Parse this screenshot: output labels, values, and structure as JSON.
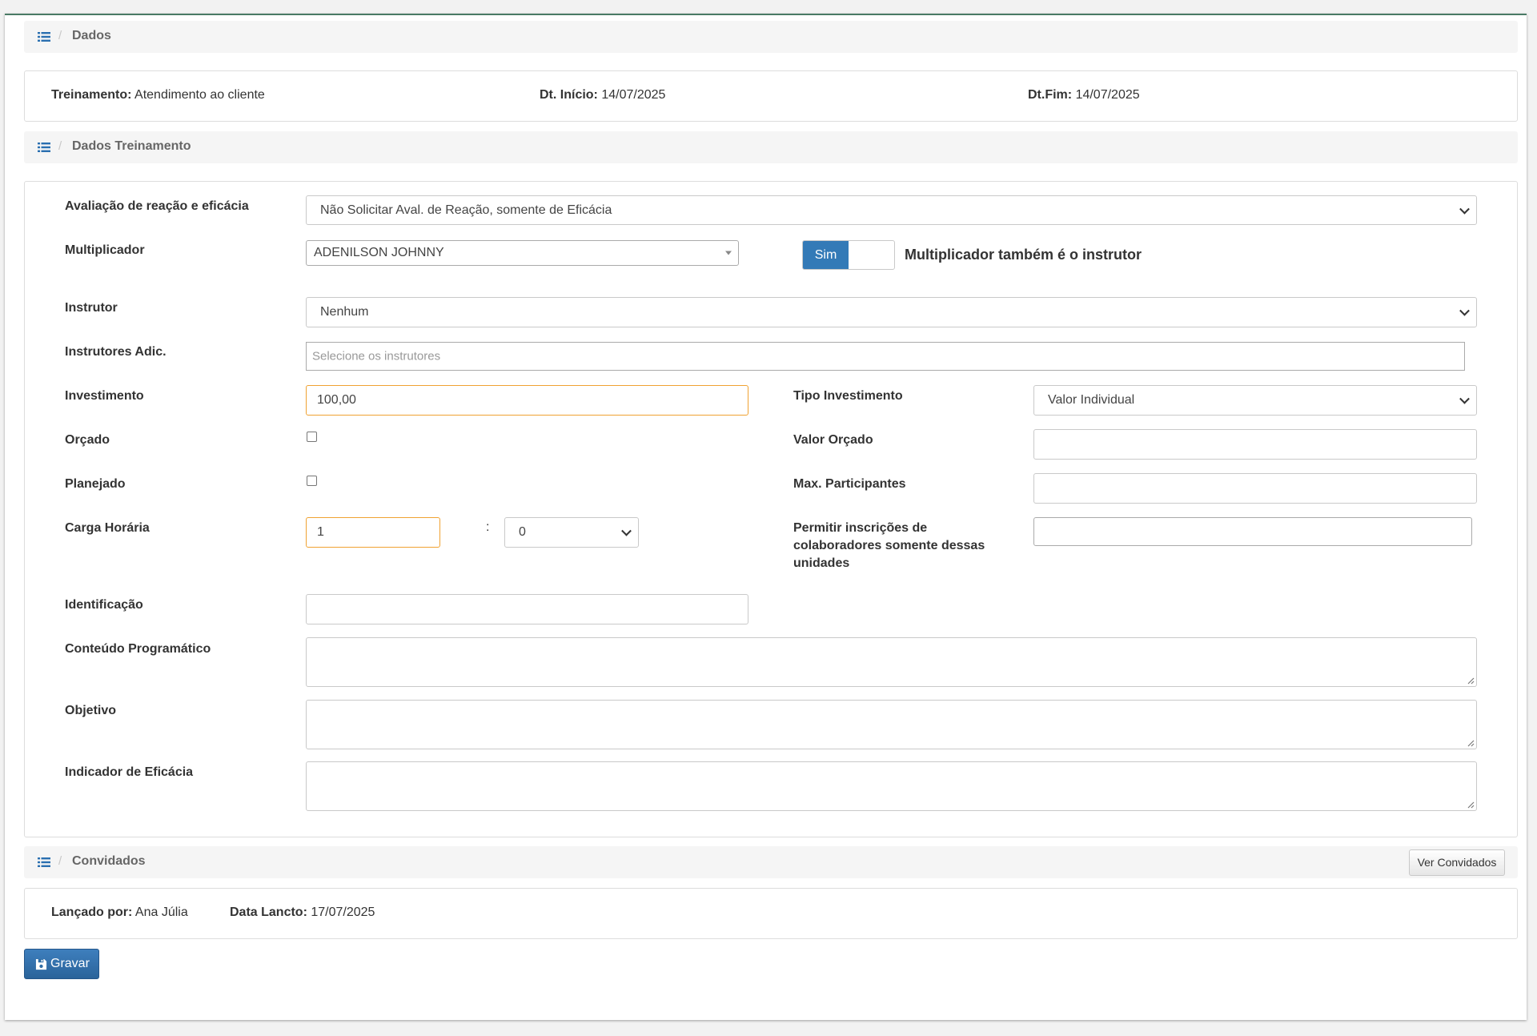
{
  "sections": {
    "dados": "Dados",
    "dados_treinamento": "Dados Treinamento",
    "convidados": "Convidados"
  },
  "summary": {
    "treinamento_label": "Treinamento:",
    "treinamento_value": "Atendimento ao cliente",
    "dt_inicio_label": "Dt. Início:",
    "dt_inicio_value": "14/07/2025",
    "dt_fim_label": "Dt.Fim:",
    "dt_fim_value": "14/07/2025"
  },
  "form": {
    "avaliacao_label": "Avaliação de reação e eficácia",
    "avaliacao_value": "Não Solicitar Aval. de Reação, somente de Eficácia",
    "multiplicador_label": "Multiplicador",
    "multiplicador_value": "ADENILSON JOHNNY",
    "toggle_on_label": "Sim",
    "toggle_caption": "Multiplicador também é o instrutor",
    "instrutor_label": "Instrutor",
    "instrutor_value": "Nenhum",
    "instrutores_adic_label": "Instrutores Adic.",
    "instrutores_adic_placeholder": "Selecione os instrutores",
    "investimento_label": "Investimento",
    "investimento_value": "100,00",
    "tipo_investimento_label": "Tipo Investimento",
    "tipo_investimento_value": "Valor Individual",
    "orcado_label": "Orçado",
    "valor_orcado_label": "Valor Orçado",
    "planejado_label": "Planejado",
    "max_participantes_label": "Max. Participantes",
    "carga_horaria_label": "Carga Horária",
    "carga_horas_value": "1",
    "carga_separator": ":",
    "carga_minutos_value": "0",
    "permitir_label_line1": "Permitir inscrições de",
    "permitir_label_line2": "colaboradores somente dessas",
    "permitir_label_line3": "unidades",
    "identificacao_label": "Identificação",
    "conteudo_label": "Conteúdo Programático",
    "objetivo_label": "Objetivo",
    "indicador_label": "Indicador de Eficácia"
  },
  "convidados": {
    "ver_button": "Ver Convidados"
  },
  "footer": {
    "lancado_label": "Lançado por:",
    "lancado_value": "Ana Júlia",
    "data_label": "Data Lancto:",
    "data_value": "17/07/2025",
    "save_button": "Gravar"
  },
  "icons": {
    "section": "list-icon",
    "save": "floppy-disk-icon"
  },
  "colors": {
    "primary": "#337ab7",
    "focus_orange": "#f0a232",
    "breadcrumb_bg": "#f5f5f5"
  }
}
